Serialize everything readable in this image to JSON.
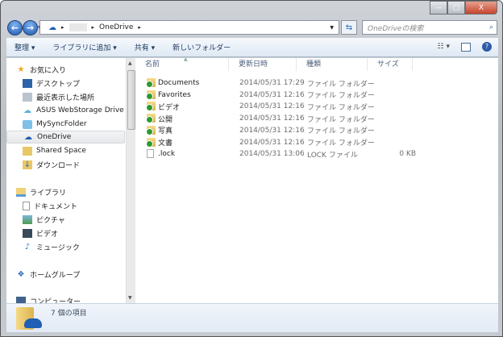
{
  "window": {
    "min": "—",
    "max": "▢",
    "close": "X"
  },
  "address": {
    "crumbs": [
      "OneDrive"
    ],
    "sep": "▸"
  },
  "search": {
    "placeholder": "OneDriveの検索"
  },
  "toolbar": {
    "organize": "整理 ▾",
    "add_library": "ライブラリに追加 ▾",
    "share": "共有 ▾",
    "new_folder": "新しいフォルダー",
    "help": "?"
  },
  "nav": {
    "favorites": "お気に入り",
    "fav_items": [
      "デスクトップ",
      "最近表示した場所",
      "ASUS WebStorage Drive",
      "MySyncFolder",
      "OneDrive",
      "Shared Space",
      "ダウンロード"
    ],
    "libraries": "ライブラリ",
    "lib_items": [
      "ドキュメント",
      "ピクチャ",
      "ビデオ",
      "ミュージック"
    ],
    "homegroup": "ホームグループ",
    "computer": "コンピューター"
  },
  "columns": [
    "名前",
    "更新日時",
    "種類",
    "サイズ"
  ],
  "files": [
    {
      "name": "Documents",
      "date": "2014/05/31 17:29",
      "type": "ファイル フォルダー",
      "size": ""
    },
    {
      "name": "Favorites",
      "date": "2014/05/31 12:16",
      "type": "ファイル フォルダー",
      "size": ""
    },
    {
      "name": "ビデオ",
      "date": "2014/05/31 12:16",
      "type": "ファイル フォルダー",
      "size": ""
    },
    {
      "name": "公開",
      "date": "2014/05/31 12:16",
      "type": "ファイル フォルダー",
      "size": ""
    },
    {
      "name": "写真",
      "date": "2014/05/31 12:16",
      "type": "ファイル フォルダー",
      "size": ""
    },
    {
      "name": "文書",
      "date": "2014/05/31 12:16",
      "type": "ファイル フォルダー",
      "size": ""
    },
    {
      "name": ".lock",
      "date": "2014/05/31 13:06",
      "type": "LOCK ファイル",
      "size": "0 KB"
    }
  ],
  "status": {
    "count": "7 個の項目"
  }
}
